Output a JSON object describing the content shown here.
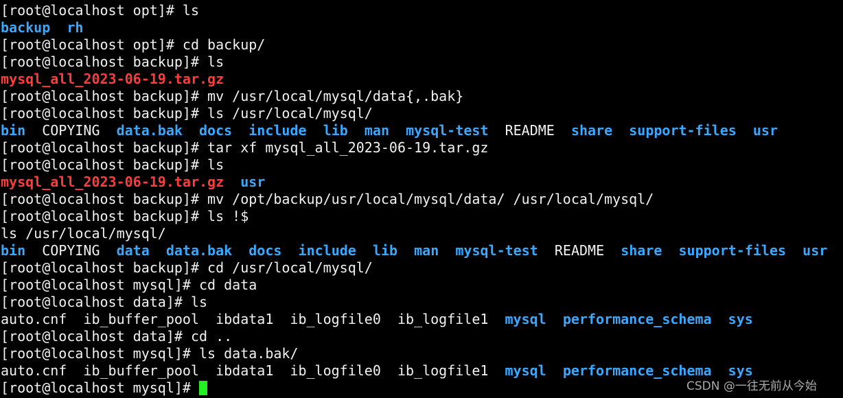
{
  "colors": {
    "text": "#f2f2f2",
    "directory": "#3aa8ff",
    "archive": "#ff3c3c",
    "cursor": "#22ee22",
    "background": "#000000"
  },
  "lines": [
    [
      {
        "t": "[root@localhost opt]# ls"
      }
    ],
    [
      {
        "t": "backup",
        "c": "dir"
      },
      {
        "t": "  "
      },
      {
        "t": "rh",
        "c": "dir"
      }
    ],
    [
      {
        "t": "[root@localhost opt]# cd backup/"
      }
    ],
    [
      {
        "t": "[root@localhost backup]# ls"
      }
    ],
    [
      {
        "t": "mysql_all_2023-06-19.tar.gz",
        "c": "arc"
      }
    ],
    [
      {
        "t": "[root@localhost backup]# mv /usr/local/mysql/data{,.bak}"
      }
    ],
    [
      {
        "t": "[root@localhost backup]# ls /usr/local/mysql/"
      }
    ],
    [
      {
        "t": "bin",
        "c": "dir"
      },
      {
        "t": "  COPYING  "
      },
      {
        "t": "data.bak",
        "c": "dir"
      },
      {
        "t": "  "
      },
      {
        "t": "docs",
        "c": "dir"
      },
      {
        "t": "  "
      },
      {
        "t": "include",
        "c": "dir"
      },
      {
        "t": "  "
      },
      {
        "t": "lib",
        "c": "dir"
      },
      {
        "t": "  "
      },
      {
        "t": "man",
        "c": "dir"
      },
      {
        "t": "  "
      },
      {
        "t": "mysql-test",
        "c": "dir"
      },
      {
        "t": "  README  "
      },
      {
        "t": "share",
        "c": "dir"
      },
      {
        "t": "  "
      },
      {
        "t": "support-files",
        "c": "dir"
      },
      {
        "t": "  "
      },
      {
        "t": "usr",
        "c": "dir"
      }
    ],
    [
      {
        "t": "[root@localhost backup]# tar xf mysql_all_2023-06-19.tar.gz"
      }
    ],
    [
      {
        "t": "[root@localhost backup]# ls"
      }
    ],
    [
      {
        "t": "mysql_all_2023-06-19.tar.gz",
        "c": "arc"
      },
      {
        "t": "  "
      },
      {
        "t": "usr",
        "c": "dir"
      }
    ],
    [
      {
        "t": "[root@localhost backup]# mv /opt/backup/usr/local/mysql/data/ /usr/local/mysql/"
      }
    ],
    [
      {
        "t": "[root@localhost backup]# ls !$"
      }
    ],
    [
      {
        "t": "ls /usr/local/mysql/"
      }
    ],
    [
      {
        "t": "bin",
        "c": "dir"
      },
      {
        "t": "  COPYING  "
      },
      {
        "t": "data",
        "c": "dir"
      },
      {
        "t": "  "
      },
      {
        "t": "data.bak",
        "c": "dir"
      },
      {
        "t": "  "
      },
      {
        "t": "docs",
        "c": "dir"
      },
      {
        "t": "  "
      },
      {
        "t": "include",
        "c": "dir"
      },
      {
        "t": "  "
      },
      {
        "t": "lib",
        "c": "dir"
      },
      {
        "t": "  "
      },
      {
        "t": "man",
        "c": "dir"
      },
      {
        "t": "  "
      },
      {
        "t": "mysql-test",
        "c": "dir"
      },
      {
        "t": "  README  "
      },
      {
        "t": "share",
        "c": "dir"
      },
      {
        "t": "  "
      },
      {
        "t": "support-files",
        "c": "dir"
      },
      {
        "t": "  "
      },
      {
        "t": "usr",
        "c": "dir"
      }
    ],
    [
      {
        "t": "[root@localhost backup]# cd /usr/local/mysql/"
      }
    ],
    [
      {
        "t": "[root@localhost mysql]# cd data"
      }
    ],
    [
      {
        "t": "[root@localhost data]# ls"
      }
    ],
    [
      {
        "t": "auto.cnf  ib_buffer_pool  ibdata1  ib_logfile0  ib_logfile1  "
      },
      {
        "t": "mysql",
        "c": "dir"
      },
      {
        "t": "  "
      },
      {
        "t": "performance_schema",
        "c": "dir"
      },
      {
        "t": "  "
      },
      {
        "t": "sys",
        "c": "dir"
      }
    ],
    [
      {
        "t": "[root@localhost data]# cd .."
      }
    ],
    [
      {
        "t": "[root@localhost mysql]# ls data.bak/"
      }
    ],
    [
      {
        "t": "auto.cnf  ib_buffer_pool  ibdata1  ib_logfile0  ib_logfile1  "
      },
      {
        "t": "mysql",
        "c": "dir"
      },
      {
        "t": "  "
      },
      {
        "t": "performance_schema",
        "c": "dir"
      },
      {
        "t": "  "
      },
      {
        "t": "sys",
        "c": "dir"
      }
    ],
    [
      {
        "t": "[root@localhost mysql]# "
      }
    ]
  ],
  "watermark": "CSDN @一往无前从今始"
}
